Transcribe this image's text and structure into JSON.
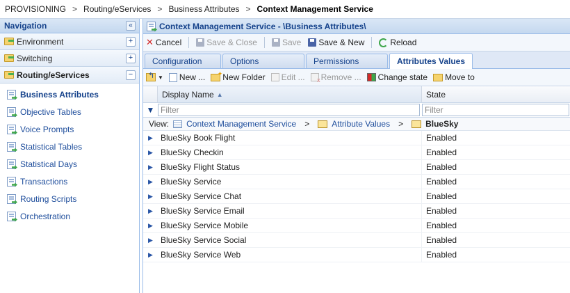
{
  "breadcrumb": {
    "items": [
      "PROVISIONING",
      "Routing/eServices",
      "Business Attributes"
    ],
    "current": "Context Management Service",
    "separator": ">"
  },
  "sidebar": {
    "title": "Navigation",
    "collapse_symbol": "«",
    "sections": [
      {
        "label": "Environment",
        "toggle": "+"
      },
      {
        "label": "Switching",
        "toggle": "+"
      },
      {
        "label": "Routing/eServices",
        "toggle": "−"
      }
    ],
    "items": [
      {
        "label": "Business Attributes"
      },
      {
        "label": "Objective Tables"
      },
      {
        "label": "Voice Prompts"
      },
      {
        "label": "Statistical Tables"
      },
      {
        "label": "Statistical Days"
      },
      {
        "label": "Transactions"
      },
      {
        "label": "Routing Scripts"
      },
      {
        "label": "Orchestration"
      }
    ]
  },
  "panel": {
    "title": "Context Management Service - \\Business Attributes\\"
  },
  "toolbar": {
    "cancel": "Cancel",
    "save_close": "Save & Close",
    "save": "Save",
    "save_new": "Save & New",
    "reload": "Reload"
  },
  "tabs": [
    "Configuration",
    "Options",
    "Permissions",
    "Attributes Values"
  ],
  "grid_toolbar": {
    "new": "New ...",
    "new_folder": "New Folder",
    "edit": "Edit ...",
    "remove": "Remove ...",
    "change_state": "Change state",
    "move_to": "Move to"
  },
  "grid": {
    "columns": [
      "Display Name",
      "State"
    ],
    "filter_placeholder": "Filter",
    "view_label": "View:",
    "view_path": [
      "Context Management Service",
      "Attribute Values",
      "BlueSky"
    ],
    "rows": [
      {
        "name": "BlueSky Book Flight",
        "state": "Enabled"
      },
      {
        "name": "BlueSky Checkin",
        "state": "Enabled"
      },
      {
        "name": "BlueSky Flight Status",
        "state": "Enabled"
      },
      {
        "name": "BlueSky Service",
        "state": "Enabled"
      },
      {
        "name": "BlueSky Service Chat",
        "state": "Enabled"
      },
      {
        "name": "BlueSky Service Email",
        "state": "Enabled"
      },
      {
        "name": "BlueSky Service Mobile",
        "state": "Enabled"
      },
      {
        "name": "BlueSky Service Social",
        "state": "Enabled"
      },
      {
        "name": "BlueSky Service Web",
        "state": "Enabled"
      }
    ]
  }
}
